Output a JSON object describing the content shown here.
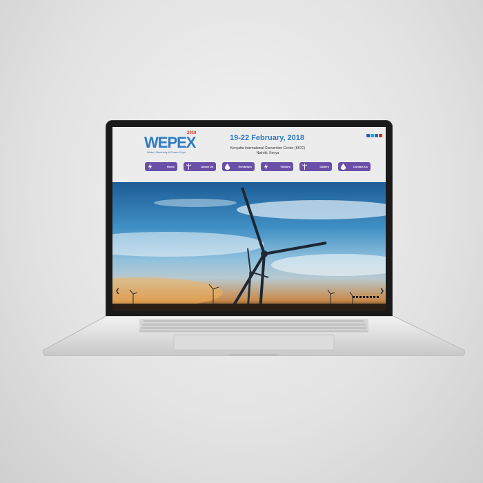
{
  "site": {
    "logo_text": "WEPEX",
    "logo_year": "2018",
    "logo_tagline": "Water, Electricity & Power Expo",
    "event_date": "19-22 February, 2018",
    "venue_line1": "Kenyatta International Convention Center (KICC)",
    "venue_line2": "Nairobi, Kenya"
  },
  "social": [
    "facebook-icon",
    "twitter-icon",
    "linkedin-icon",
    "youtube-icon"
  ],
  "nav": [
    {
      "label": "Home",
      "icon": "lightning-icon"
    },
    {
      "label": "About Us",
      "icon": "wind-turbine-icon"
    },
    {
      "label": "Exhibitors",
      "icon": "water-drop-icon"
    },
    {
      "label": "Visitors",
      "icon": "lightning-icon"
    },
    {
      "label": "Gallery",
      "icon": "wind-turbine-icon"
    },
    {
      "label": "Contact Us",
      "icon": "water-drop-icon"
    }
  ],
  "colors": {
    "brand_blue": "#2e7bc4",
    "nav_purple": "#6a4fa8",
    "header_bg": "#ececec"
  }
}
